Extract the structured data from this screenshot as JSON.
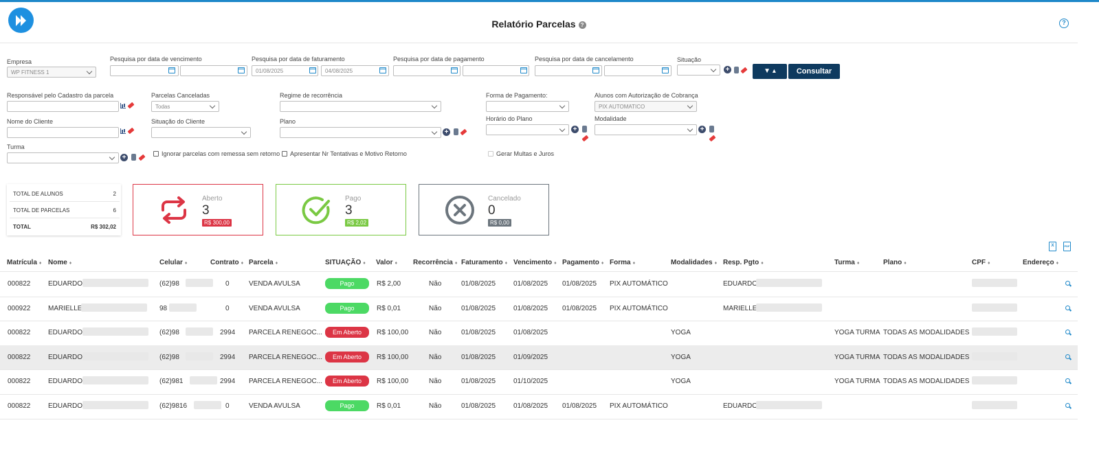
{
  "header": {
    "title": "Relatório Parcelas",
    "title_help": "?",
    "help_icon": "question-circle-icon"
  },
  "filters": {
    "empresa_label": "Empresa",
    "empresa_value": "WP FITNESS 1",
    "vencimento_label": "Pesquisa por data de vencimento",
    "faturamento_label": "Pesquisa por data de faturamento",
    "faturamento_from": "01/08/2025",
    "faturamento_to": "04/08/2025",
    "pagamento_label": "Pesquisa por data de pagamento",
    "cancelamento_label": "Pesquisa por data de cancelamento",
    "situacao_label": "Situação",
    "filter_button": "▼ ▴",
    "consultar_button": "Consultar",
    "responsavel_label": "Responsável pelo Cadastro da parcela",
    "canceladas_label": "Parcelas Canceladas",
    "canceladas_value": "Todas",
    "regime_label": "Regime de recorrência",
    "forma_label": "Forma de Pagamento:",
    "autorizacao_label": "Alunos com Autorização de Cobrança",
    "autorizacao_value": "PIX AUTOMATICO",
    "nome_label": "Nome do Cliente",
    "situacao_cliente_label": "Situação do Cliente",
    "plano_label": "Plano",
    "horario_label": "Horário do Plano",
    "modalidade_label": "Modalidade",
    "turma_label": "Turma",
    "ignorar_label": "Ignorar parcelas com remessa sem retorno",
    "tentativas_label": "Apresentar Nr Tentativas e Motivo Retorno",
    "multas_label": "Gerar Multas e Juros"
  },
  "totals": [
    {
      "label": "TOTAL DE ALUNOS",
      "value": "2"
    },
    {
      "label": "TOTAL DE PARCELAS",
      "value": "6"
    },
    {
      "label": "TOTAL",
      "value": "R$ 302,02"
    }
  ],
  "cards": {
    "aberto": {
      "label": "Aberto",
      "count": "3",
      "amount": "R$ 300,00",
      "color": "#dc3545"
    },
    "pago": {
      "label": "Pago",
      "count": "3",
      "amount": "R$ 2,02",
      "color": "#7ac943"
    },
    "cancelado": {
      "label": "Cancelado",
      "count": "0",
      "amount": "R$ 0,00",
      "color": "#6c757d"
    }
  },
  "exports": {
    "excel": "X",
    "pdf": "PDF"
  },
  "table": {
    "columns": [
      "Matrícula",
      "Nome",
      "Celular",
      "Contrato",
      "Parcela",
      "SITUAÇÃO",
      "Valor",
      "Recorrência",
      "Faturamento",
      "Vencimento",
      "Pagamento",
      "Forma",
      "Modalidades",
      "Resp. Pgto",
      "Turma",
      "Plano",
      "CPF",
      "Endereço"
    ],
    "sort_glyph": "♦",
    "rows": [
      {
        "matricula": "000822",
        "nome": "EDUARDO",
        "celular": "(62)98",
        "contrato": "0",
        "parcela": "VENDA AVULSA",
        "situacao": "Pago",
        "valor": "R$ 2,00",
        "recorrencia": "Não",
        "faturamento": "01/08/2025",
        "vencimento": "01/08/2025",
        "pagamento": "01/08/2025",
        "forma": "PIX AUTOMÁTICO",
        "modalidades": "",
        "resp": "EDUARDO",
        "turma": "",
        "plano": ""
      },
      {
        "matricula": "000922",
        "nome": "MARIELLE",
        "celular": "98",
        "contrato": "0",
        "parcela": "VENDA AVULSA",
        "situacao": "Pago",
        "valor": "R$ 0,01",
        "recorrencia": "Não",
        "faturamento": "01/08/2025",
        "vencimento": "01/08/2025",
        "pagamento": "01/08/2025",
        "forma": "PIX AUTOMÁTICO",
        "modalidades": "",
        "resp": "MARIELLE",
        "turma": "",
        "plano": ""
      },
      {
        "matricula": "000822",
        "nome": "EDUARDO",
        "celular": "(62)98",
        "contrato": "2994",
        "parcela": "PARCELA RENEGOC...",
        "situacao": "Em Aberto",
        "valor": "R$ 100,00",
        "recorrencia": "Não",
        "faturamento": "01/08/2025",
        "vencimento": "01/08/2025",
        "pagamento": "",
        "forma": "",
        "modalidades": "YOGA",
        "resp": "",
        "turma": "YOGA TURMA",
        "plano": "TODAS AS MODALIDADES"
      },
      {
        "matricula": "000822",
        "nome": "EDUARDO",
        "celular": "(62)98",
        "contrato": "2994",
        "parcela": "PARCELA RENEGOC...",
        "situacao": "Em Aberto",
        "valor": "R$ 100,00",
        "recorrencia": "Não",
        "faturamento": "01/08/2025",
        "vencimento": "01/09/2025",
        "pagamento": "",
        "forma": "",
        "modalidades": "YOGA",
        "resp": "",
        "turma": "YOGA TURMA",
        "plano": "TODAS AS MODALIDADES"
      },
      {
        "matricula": "000822",
        "nome": "EDUARDO",
        "celular": "(62)981",
        "contrato": "2994",
        "parcela": "PARCELA RENEGOC...",
        "situacao": "Em Aberto",
        "valor": "R$ 100,00",
        "recorrencia": "Não",
        "faturamento": "01/08/2025",
        "vencimento": "01/10/2025",
        "pagamento": "",
        "forma": "",
        "modalidades": "YOGA",
        "resp": "",
        "turma": "YOGA TURMA",
        "plano": "TODAS AS MODALIDADES"
      },
      {
        "matricula": "000822",
        "nome": "EDUARDO",
        "celular": "(62)9816",
        "contrato": "0",
        "parcela": "VENDA AVULSA",
        "situacao": "Pago",
        "valor": "R$ 0,01",
        "recorrencia": "Não",
        "faturamento": "01/08/2025",
        "vencimento": "01/08/2025",
        "pagamento": "01/08/2025",
        "forma": "PIX AUTOMÁTICO",
        "modalidades": "",
        "resp": "EDUARDO",
        "turma": "",
        "plano": ""
      }
    ]
  },
  "status_colors": {
    "Pago": "#4cd964",
    "Em Aberto": "#dc3545"
  }
}
